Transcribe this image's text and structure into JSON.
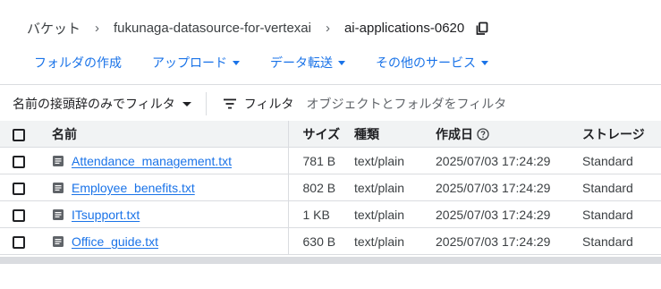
{
  "breadcrumb": {
    "root": "バケット",
    "bucket": "fukunaga-datasource-for-vertexai",
    "folder": "ai-applications-0620"
  },
  "actions": {
    "create_folder": "フォルダの作成",
    "upload": "アップロード",
    "transfer": "データ転送",
    "other_services": "その他のサービス"
  },
  "filter": {
    "prefix_label": "名前の接頭辞のみでフィルタ",
    "filter_label": "フィルタ",
    "placeholder": "オブジェクトとフォルダをフィルタ"
  },
  "table": {
    "headers": {
      "name": "名前",
      "size": "サイズ",
      "type": "種類",
      "created": "作成日",
      "storage": "ストレージ"
    },
    "rows": [
      {
        "name": "Attendance_management.txt",
        "size": "781 B",
        "type": "text/plain",
        "created": "2025/07/03 17:24:29",
        "storage": "Standard"
      },
      {
        "name": "Employee_benefits.txt",
        "size": "802 B",
        "type": "text/plain",
        "created": "2025/07/03 17:24:29",
        "storage": "Standard"
      },
      {
        "name": "ITsupport.txt",
        "size": "1 KB",
        "type": "text/plain",
        "created": "2025/07/03 17:24:29",
        "storage": "Standard"
      },
      {
        "name": "Office_guide.txt",
        "size": "630 B",
        "type": "text/plain",
        "created": "2025/07/03 17:24:29",
        "storage": "Standard"
      }
    ]
  },
  "colors": {
    "accent": "#1a73e8",
    "header_bg": "#f1f3f4",
    "divider": "#dadce0"
  },
  "icons": {
    "copy": "copy-icon",
    "filter": "filter-lines-icon",
    "file": "text-file-icon",
    "help": "help-circle-icon"
  }
}
